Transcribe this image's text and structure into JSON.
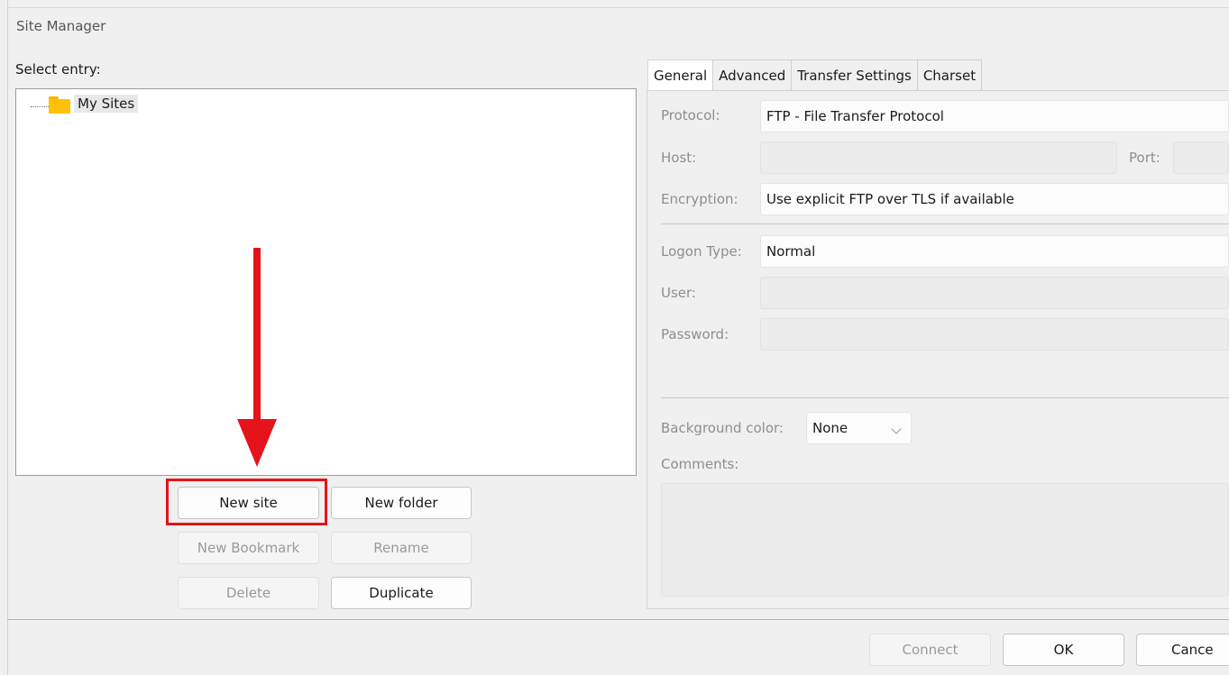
{
  "window": {
    "title": "Site Manager"
  },
  "tree": {
    "label": "Select entry:",
    "items": [
      {
        "label": "My Sites"
      }
    ]
  },
  "buttons": {
    "new_site": "New site",
    "new_folder": "New folder",
    "new_bookmark": "New Bookmark",
    "rename": "Rename",
    "delete": "Delete",
    "duplicate": "Duplicate"
  },
  "tabs": [
    "General",
    "Advanced",
    "Transfer Settings",
    "Charset"
  ],
  "general": {
    "protocol_label": "Protocol:",
    "protocol_value": "FTP - File Transfer Protocol",
    "host_label": "Host:",
    "host_value": "",
    "port_label": "Port:",
    "port_value": "",
    "encryption_label": "Encryption:",
    "encryption_value": "Use explicit FTP over TLS if available",
    "logon_type_label": "Logon Type:",
    "logon_type_value": "Normal",
    "user_label": "User:",
    "user_value": "",
    "password_label": "Password:",
    "password_value": "",
    "bg_color_label": "Background color:",
    "bg_color_value": "None",
    "comments_label": "Comments:",
    "comments_value": ""
  },
  "footer": {
    "connect": "Connect",
    "ok": "OK",
    "cancel": "Cance"
  },
  "colors": {
    "annotation": "#e5141a",
    "folder": "#ffc107"
  }
}
